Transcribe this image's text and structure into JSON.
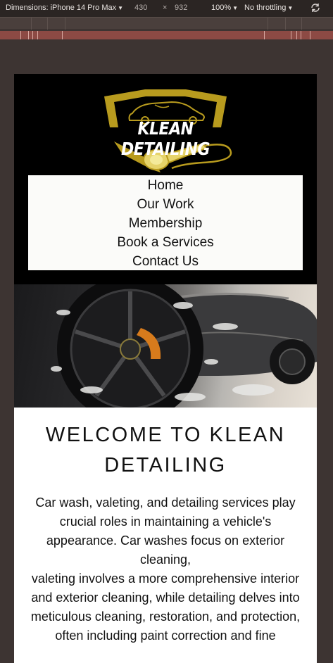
{
  "devtools": {
    "dimensions_label": "Dimensions: iPhone 14 Pro Max",
    "width": "430",
    "times": "×",
    "height": "932",
    "zoom": "100%",
    "throttling": "No throttling"
  },
  "site": {
    "logo_text": "KLEAN DETAILING",
    "brand_color": "#b89b1e",
    "nav": [
      "Home",
      "Our Work",
      "Membership",
      "Book a Services",
      "Contact Us"
    ],
    "hero_image": "car-wheel-foam-photo",
    "title": "WELCOME TO KLEAN DETAILING",
    "body_paragraphs": [
      "Car wash, valeting, and detailing services play crucial roles in maintaining a vehicle's appearance. Car washes focus on exterior cleaning,",
      "valeting involves a more comprehensive interior and exterior cleaning, while detailing delves into meticulous cleaning, restoration, and protection,",
      "often including paint correction and fine"
    ]
  }
}
